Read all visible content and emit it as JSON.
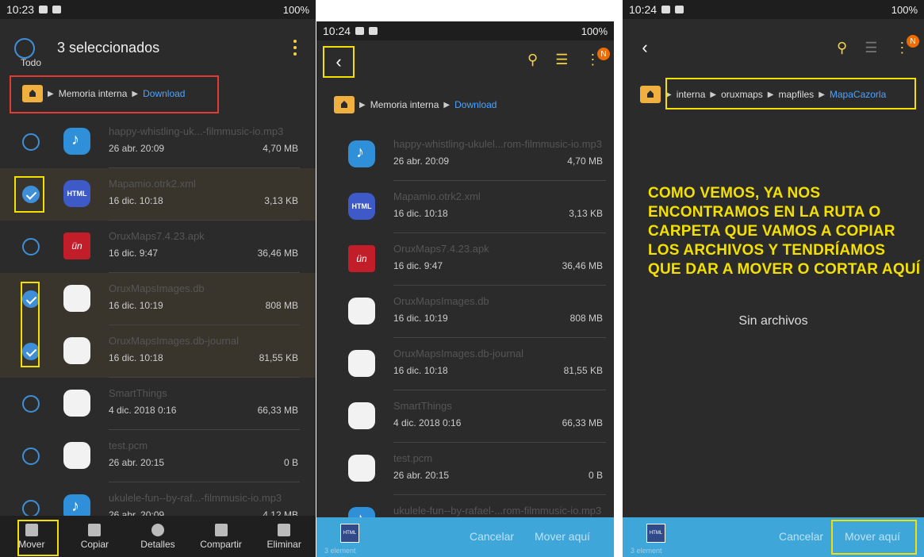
{
  "panel1": {
    "status": {
      "time": "10:23",
      "right": "100%"
    },
    "header": {
      "select_all": "Todo",
      "title": "3 seleccionados"
    },
    "breadcrumb": {
      "root": "Memoria interna",
      "current": "Download"
    },
    "files": [
      {
        "name": "happy-whistling-uk...-filmmusic-io.mp3",
        "date": "26 abr. 20:09",
        "size": "4,70 MB",
        "icon": "music",
        "selected": false
      },
      {
        "name": "Mapamio.otrk2.xml",
        "date": "16 dic. 10:18",
        "size": "3,13 KB",
        "icon": "html",
        "selected": true
      },
      {
        "name": "OruxMaps7.4.23.apk",
        "date": "16 dic. 9:47",
        "size": "36,46 MB",
        "icon": "apk",
        "selected": false
      },
      {
        "name": "OruxMapsImages.db",
        "date": "16 dic. 10:19",
        "size": "808 MB",
        "icon": "doc",
        "selected": true
      },
      {
        "name": "OruxMapsImages.db-journal",
        "date": "16 dic. 10:18",
        "size": "81,55 KB",
        "icon": "doc",
        "selected": true
      },
      {
        "name": "SmartThings",
        "date": "4 dic. 2018 0:16",
        "size": "66,33 MB",
        "icon": "doc",
        "selected": false
      },
      {
        "name": "test.pcm",
        "date": "26 abr. 20:15",
        "size": "0 B",
        "icon": "doc",
        "selected": false
      },
      {
        "name": "ukulele-fun--by-raf...-filmmusic-io.mp3",
        "date": "26 abr. 20:09",
        "size": "4,12 MB",
        "icon": "music",
        "selected": false
      }
    ],
    "bottom": [
      "Mover",
      "Copiar",
      "Detalles",
      "Compartir",
      "Eliminar"
    ]
  },
  "panel2": {
    "status": {
      "time": "10:24",
      "right": "100%"
    },
    "badge": "N",
    "breadcrumb": {
      "root": "Memoria interna",
      "current": "Download"
    },
    "files": [
      {
        "name": "happy-whistling-ukulel...rom-filmmusic-io.mp3",
        "date": "26 abr. 20:09",
        "size": "4,70 MB",
        "icon": "music"
      },
      {
        "name": "Mapamio.otrk2.xml",
        "date": "16 dic. 10:18",
        "size": "3,13 KB",
        "icon": "html"
      },
      {
        "name": "OruxMaps7.4.23.apk",
        "date": "16 dic. 9:47",
        "size": "36,46 MB",
        "icon": "apk"
      },
      {
        "name": "OruxMapsImages.db",
        "date": "16 dic. 10:19",
        "size": "808 MB",
        "icon": "doc"
      },
      {
        "name": "OruxMapsImages.db-journal",
        "date": "16 dic. 10:18",
        "size": "81,55 KB",
        "icon": "doc"
      },
      {
        "name": "SmartThings",
        "date": "4 dic. 2018 0:16",
        "size": "66,33 MB",
        "icon": "doc"
      },
      {
        "name": "test.pcm",
        "date": "26 abr. 20:15",
        "size": "0 B",
        "icon": "doc"
      },
      {
        "name": "ukulele-fun--by-rafael-...rom-filmmusic-io.mp3",
        "date": "26 abr. 20:09",
        "size": "4,12 MB",
        "icon": "music"
      }
    ],
    "bottom": {
      "count": "3 element",
      "cancel": "Cancelar",
      "move_here": "Mover aquí"
    }
  },
  "panel3": {
    "status": {
      "time": "10:24",
      "right": "100%"
    },
    "badge": "N",
    "breadcrumb": [
      "interna",
      "oruxmaps",
      "mapfiles",
      "MapaCazorla"
    ],
    "annotation": "COMO VEMOS, YA NOS ENCONTRAMOS EN LA RUTA O CARPETA QUE VAMOS A COPIAR LOS ARCHIVOS Y TENDRÍAMOS QUE DAR A MOVER O CORTAR AQUÍ",
    "empty": "Sin archivos",
    "bottom": {
      "count": "3 element",
      "cancel": "Cancelar",
      "move_here": "Mover aquí"
    }
  },
  "colors": {
    "accent_blue": "#3f8fd8",
    "highlight_yellow": "#f4e000",
    "highlight_red": "#e53935",
    "folder": "#f0b040",
    "action_bar": "#3ea6d8"
  }
}
